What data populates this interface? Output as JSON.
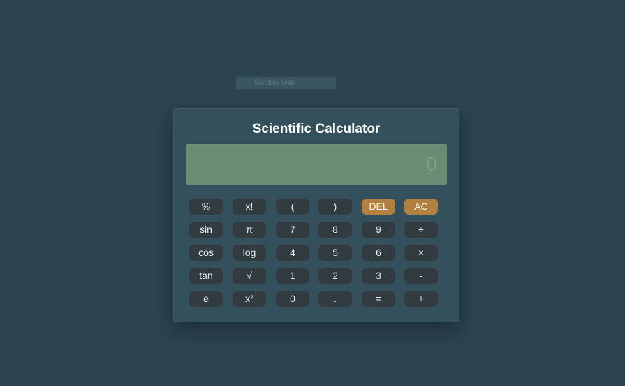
{
  "snip_bar": {
    "label": "Window Snip"
  },
  "calculator": {
    "title": "Scientific Calculator",
    "display": "0",
    "buttons": [
      [
        "%",
        "x!",
        "(",
        ")",
        "DEL",
        "AC"
      ],
      [
        "sin",
        "π",
        "7",
        "8",
        "9",
        "÷"
      ],
      [
        "cos",
        "log",
        "4",
        "5",
        "6",
        "×"
      ],
      [
        "tan",
        "√",
        "1",
        "2",
        "3",
        "-"
      ],
      [
        "e",
        "x²",
        "0",
        ".",
        "=",
        "+"
      ]
    ]
  },
  "colors": {
    "background": "#2b444f",
    "panel": "#34505c",
    "display": "#6a8c72",
    "button": "#323b3f",
    "accent": "#b4803e"
  }
}
